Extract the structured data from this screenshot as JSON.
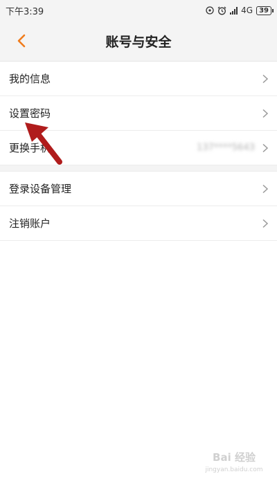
{
  "status_bar": {
    "time": "下午3:39",
    "network": "4G",
    "network_sup": "ᵢₗ",
    "battery": "39"
  },
  "header": {
    "title": "账号与安全",
    "back_icon": "chevron-left-icon",
    "accent_color": "#f07c1c"
  },
  "list": {
    "items": [
      {
        "label": "我的信息",
        "value": ""
      },
      {
        "label": "设置密码",
        "value": ""
      },
      {
        "label": "更换手机",
        "value": "137****5643"
      },
      {
        "label": "登录设备管理",
        "value": ""
      },
      {
        "label": "注销账户",
        "value": ""
      }
    ]
  },
  "annotation": {
    "arrow_color": "#b01c1c",
    "points_to": "设置密码"
  },
  "watermark": {
    "text": "Bai 经验",
    "sub": "jingyan.baidu.com"
  }
}
